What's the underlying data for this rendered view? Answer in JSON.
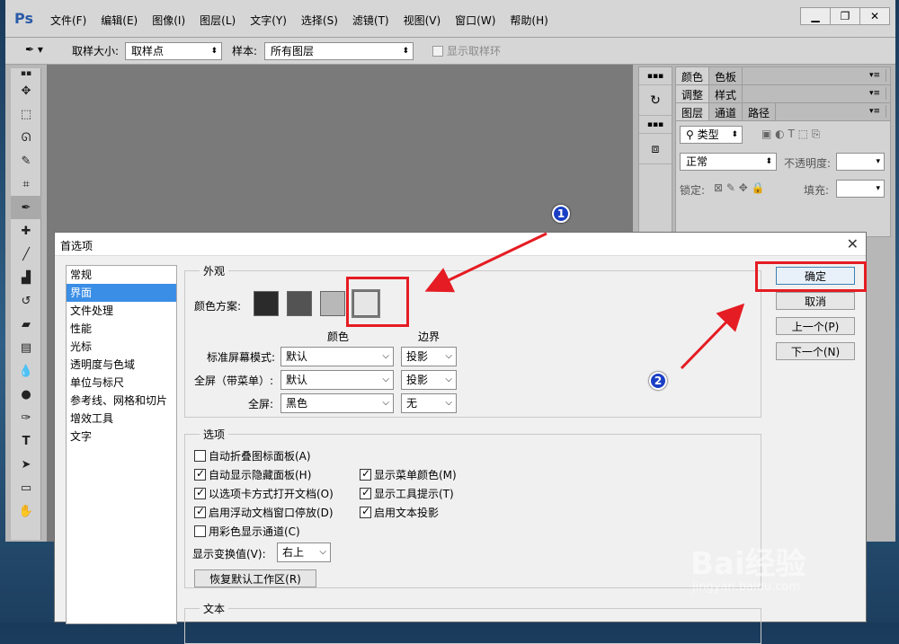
{
  "app": {
    "logo": "Ps",
    "menus": [
      "文件(F)",
      "编辑(E)",
      "图像(I)",
      "图层(L)",
      "文字(Y)",
      "选择(S)",
      "滤镜(T)",
      "视图(V)",
      "窗口(W)",
      "帮助(H)"
    ],
    "window_controls": {
      "minimize": "▁",
      "restore": "❐",
      "close": "✕"
    }
  },
  "options_bar": {
    "sample_size_label": "取样大小:",
    "sample_size_value": "取样点",
    "sample_label": "样本:",
    "sample_value": "所有图层",
    "show_ring_label": "显示取样环"
  },
  "panels": {
    "group1_tabs": [
      "颜色",
      "色板"
    ],
    "group2_tabs": [
      "调整",
      "样式"
    ],
    "group3_tabs": [
      "图层",
      "通道",
      "路径"
    ],
    "filter_label": "类型",
    "blend_mode": "正常",
    "opacity_label": "不透明度:",
    "lock_label": "锁定:",
    "fill_label": "填充:"
  },
  "dialog": {
    "title": "首选项",
    "categories": [
      "常规",
      "界面",
      "文件处理",
      "性能",
      "光标",
      "透明度与色域",
      "单位与标尺",
      "参考线、网格和切片",
      "增效工具",
      "文字"
    ],
    "selected_category": "界面",
    "appearance": {
      "group_label": "外观",
      "color_scheme_label": "颜色方案:",
      "swatches": [
        "#2b2b2b",
        "#535353",
        "#b8b8b8",
        "#e6e6e6"
      ],
      "col_color": "颜色",
      "col_border": "边界",
      "rows": [
        {
          "label": "标准屏幕模式:",
          "color": "默认",
          "border": "投影"
        },
        {
          "label": "全屏（带菜单）:",
          "color": "默认",
          "border": "投影"
        },
        {
          "label": "全屏:",
          "color": "黑色",
          "border": "无"
        }
      ]
    },
    "options": {
      "group_label": "选项",
      "checkboxes_left": [
        {
          "label": "自动折叠图标面板(A)",
          "checked": false
        },
        {
          "label": "自动显示隐藏面板(H)",
          "checked": true
        },
        {
          "label": "以选项卡方式打开文档(O)",
          "checked": true
        },
        {
          "label": "启用浮动文档窗口停放(D)",
          "checked": true
        },
        {
          "label": "用彩色显示通道(C)",
          "checked": false
        }
      ],
      "checkboxes_right": [
        {
          "label": "显示菜单颜色(M)",
          "checked": true
        },
        {
          "label": "显示工具提示(T)",
          "checked": true
        },
        {
          "label": "启用文本投影",
          "checked": true
        }
      ],
      "transform_label": "显示变换值(V):",
      "transform_value": "右上",
      "reset_button": "恢复默认工作区(R)"
    },
    "text_group_label": "文本",
    "buttons": {
      "ok": "确定",
      "cancel": "取消",
      "prev": "上一个(P)",
      "next": "下一个(N)"
    }
  },
  "annotations": {
    "marker1": "1",
    "marker2": "2",
    "accent": "#e51c23"
  },
  "watermark": {
    "brand": "Bai经验",
    "url": "jingyan.baidu.com"
  }
}
